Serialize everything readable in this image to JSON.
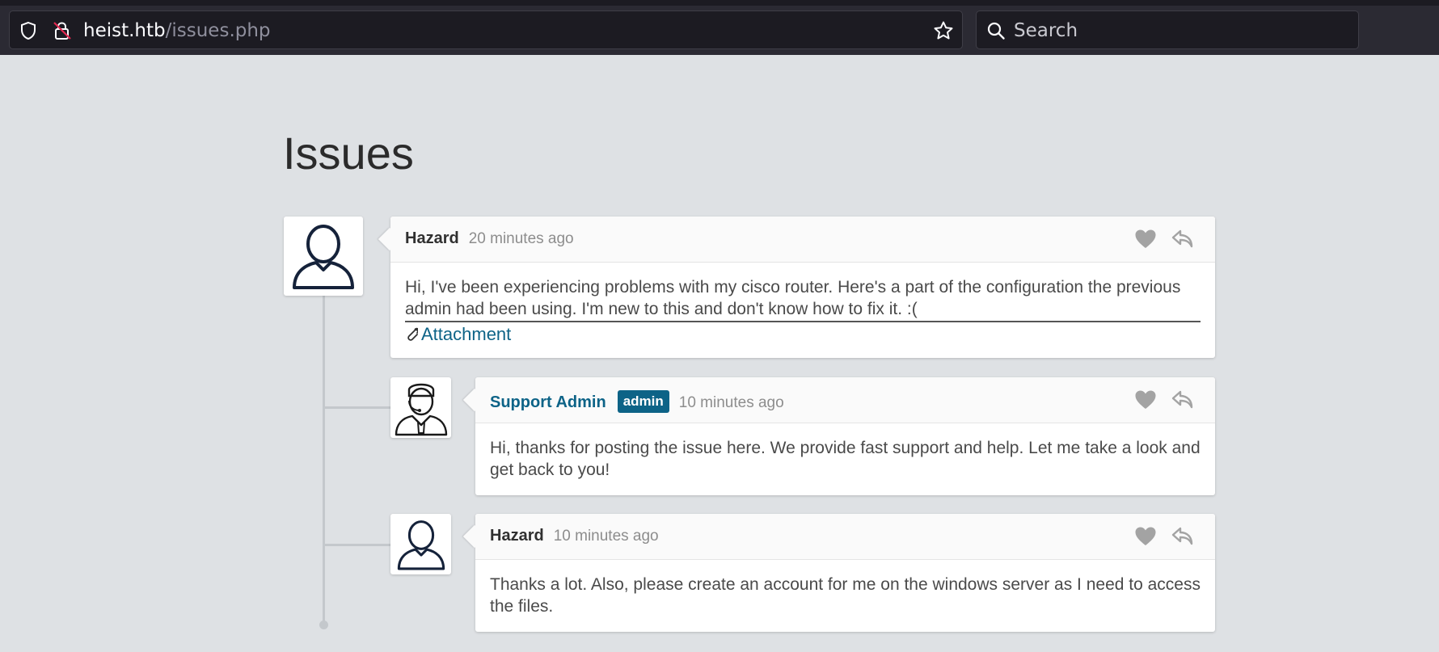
{
  "browser": {
    "url_host": "heist.htb",
    "url_path": "/issues.php",
    "search_placeholder": "Search"
  },
  "page": {
    "title": "Issues"
  },
  "comments": [
    {
      "author": "Hazard",
      "time": "20 minutes ago",
      "text": "Hi, I've been experiencing problems with my cisco router. Here's a part of the configuration the previous admin had been using. I'm new to this and don't know how to fix it. :(",
      "attachment_label": "Attachment",
      "avatar": "user-icon"
    },
    {
      "author": "Support Admin",
      "badge": "admin",
      "time": "10 minutes ago",
      "text": "Hi, thanks for posting the issue here. We provide fast support and help. Let me take a look and get back to you!",
      "avatar": "support-agent-icon"
    },
    {
      "author": "Hazard",
      "time": "10 minutes ago",
      "text": "Thanks a lot. Also, please create an account for me on the windows server as I need to access the files.",
      "avatar": "user-icon"
    }
  ],
  "colors": {
    "accent": "#0d6387",
    "background": "#dee1e4",
    "action_icon": "#a3a3a3"
  }
}
